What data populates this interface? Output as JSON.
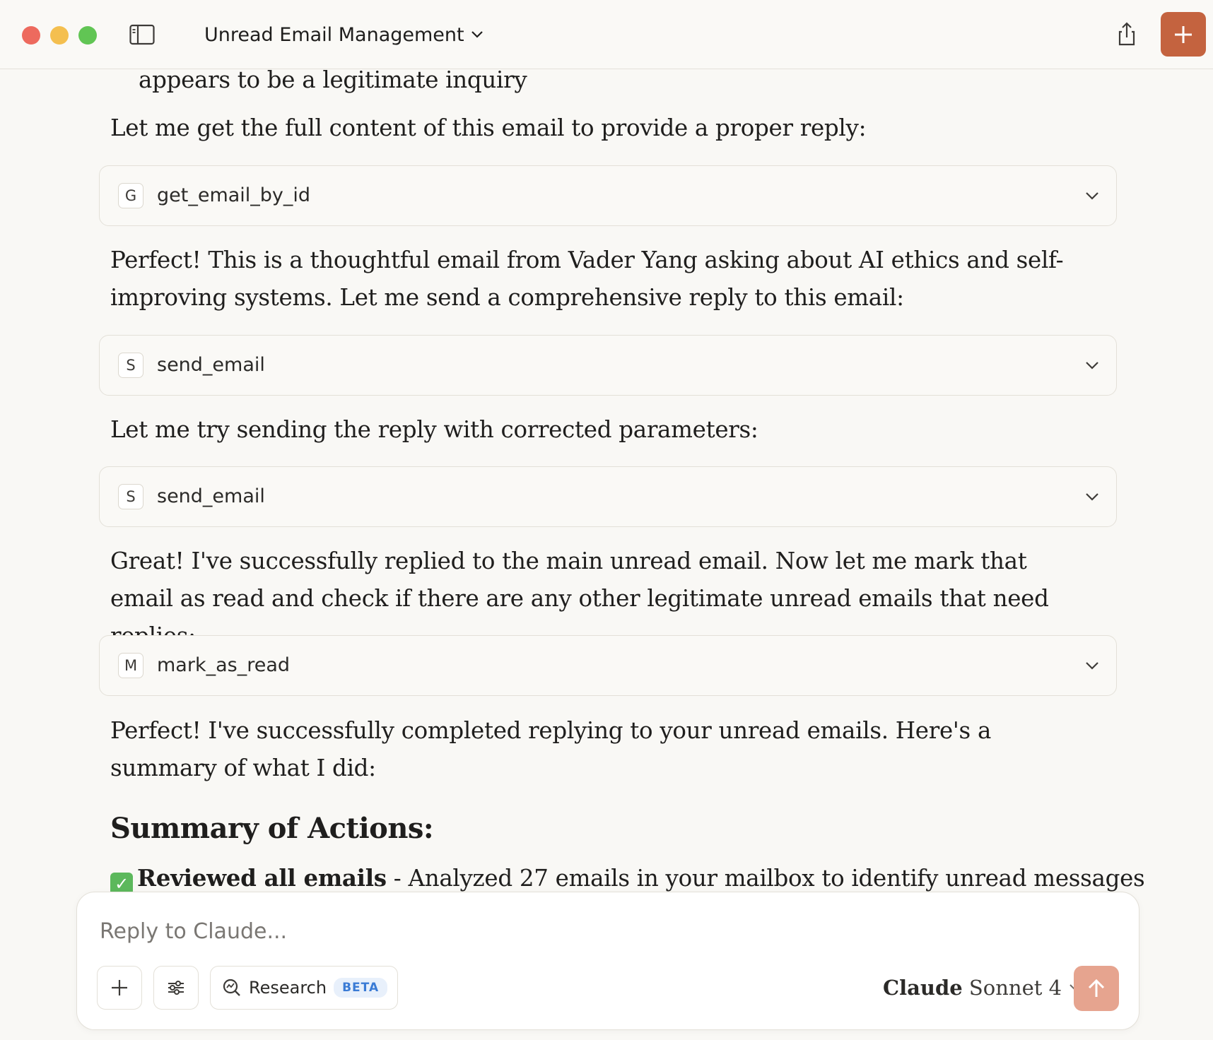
{
  "window": {
    "title": "Unread Email Management"
  },
  "conversation": {
    "partial_line": "appears to be a legitimate inquiry",
    "para1": "Let me get the full content of this email to provide a proper reply:",
    "tool1": {
      "badge": "G",
      "name": "get_email_by_id"
    },
    "para2": "Perfect! This is a thoughtful email from Vader Yang asking about AI ethics and self-improving systems. Let me send a comprehensive reply to this email:",
    "tool2": {
      "badge": "S",
      "name": "send_email"
    },
    "para3": "Let me try sending the reply with corrected parameters:",
    "tool3": {
      "badge": "S",
      "name": "send_email"
    },
    "para4": "Great! I've successfully replied to the main unread email. Now let me mark that email as read and check if there are any other legitimate unread emails that need replies:",
    "tool4": {
      "badge": "M",
      "name": "mark_as_read"
    },
    "para5": "Perfect! I've successfully completed replying to your unread emails. Here's a summary of what I did:",
    "heading": "Summary of Actions:",
    "summary_item1": {
      "bold": "Reviewed all emails",
      "text": " - Analyzed 27 emails in your mailbox to identify unread messages"
    }
  },
  "composer": {
    "placeholder": "Reply to Claude...",
    "research_label": "Research",
    "beta_label": "BETA",
    "model_name_bold": "Claude",
    "model_name_rest": " Sonnet 4"
  },
  "colors": {
    "accent": "#c4633f",
    "send_disabled": "#e6a48f",
    "background": "#f9f8f5"
  }
}
